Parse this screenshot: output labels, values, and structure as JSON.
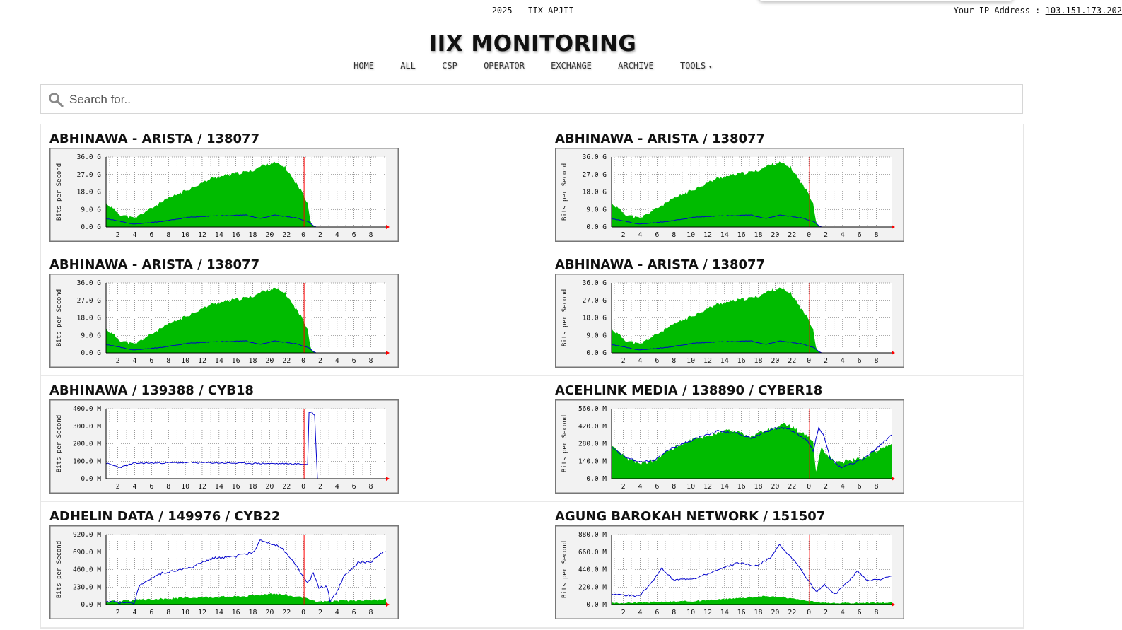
{
  "header": {
    "top_text": "2025 - IIX APJII",
    "ip_label": "Your IP Address : ",
    "ip_value": "103.151.173.202",
    "title": "IIX MONITORING"
  },
  "nav": {
    "items": [
      "HOME",
      "ALL",
      "CSP",
      "OPERATOR",
      "EXCHANGE",
      "ARCHIVE",
      "TOOLS"
    ],
    "tools_caret": "▾"
  },
  "search": {
    "placeholder": "Search for.."
  },
  "graph_labels": {
    "y_axis": "Bits per Second",
    "x_ticks": [
      "2",
      "4",
      "6",
      "8",
      "10",
      "12",
      "14",
      "16",
      "18",
      "20",
      "22",
      "0",
      "2",
      "4",
      "6",
      "8"
    ]
  },
  "colors": {
    "in_fill": "#00bb00",
    "out_line": "#0000cc",
    "now_line": "#ff0000",
    "grid": "#555555"
  },
  "graphs": [
    {
      "title": "ABHINAWA - ARISTA / 138077",
      "y_ticks": [
        "36.0 G",
        "27.0 G",
        "18.0 G",
        "9.0 G",
        "0.0 G"
      ],
      "shape": "a"
    },
    {
      "title": "ABHINAWA - ARISTA / 138077",
      "y_ticks": [
        "36.0 G",
        "27.0 G",
        "18.0 G",
        "9.0 G",
        "0.0 G"
      ],
      "shape": "a"
    },
    {
      "title": "ABHINAWA - ARISTA / 138077",
      "y_ticks": [
        "36.0 G",
        "27.0 G",
        "18.0 G",
        "9.0 G",
        "0.0 G"
      ],
      "shape": "a"
    },
    {
      "title": "ABHINAWA - ARISTA / 138077",
      "y_ticks": [
        "36.0 G",
        "27.0 G",
        "18.0 G",
        "9.0 G",
        "0.0 G"
      ],
      "shape": "a"
    },
    {
      "title": "ABHINAWA / 139388 / CYB18",
      "y_ticks": [
        "400.0 M",
        "300.0 M",
        "200.0 M",
        "100.0 M",
        "0.0 M"
      ],
      "shape": "b"
    },
    {
      "title": "ACEHLINK MEDIA / 138890 / CYBER18",
      "y_ticks": [
        "560.0 M",
        "420.0 M",
        "280.0 M",
        "140.0 M",
        "0.0 M"
      ],
      "shape": "c"
    },
    {
      "title": "ADHELIN DATA / 149976 / CYB22",
      "y_ticks": [
        "920.0 M",
        "690.0 M",
        "460.0 M",
        "230.0 M",
        "0.0 M"
      ],
      "shape": "d"
    },
    {
      "title": "AGUNG BAROKAH NETWORK / 151507",
      "y_ticks": [
        "880.0 M",
        "660.0 M",
        "440.0 M",
        "220.0 M",
        "0.0 M"
      ],
      "shape": "e"
    }
  ]
}
